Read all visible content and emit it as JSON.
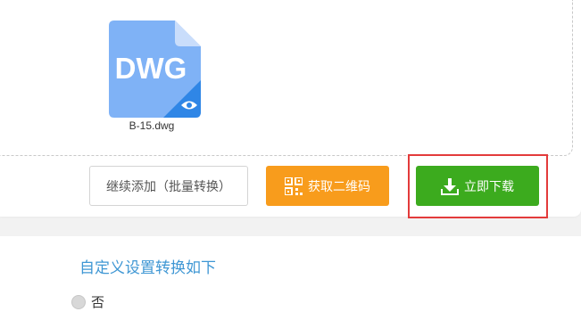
{
  "file": {
    "badge": "DWG",
    "name": "B-15.dwg"
  },
  "buttons": {
    "add_more": "继续添加（批量转换）",
    "get_qr": "获取二维码",
    "download": "立即下载"
  },
  "settings": {
    "title": "自定义设置转换如下",
    "options": [
      {
        "label": "否"
      }
    ]
  },
  "colors": {
    "file_icon": "#6aa3f2",
    "qr_button": "#f89c1c",
    "download_button": "#3cab1e",
    "highlight": "#e33b3b",
    "settings_title": "#3f97d4"
  }
}
